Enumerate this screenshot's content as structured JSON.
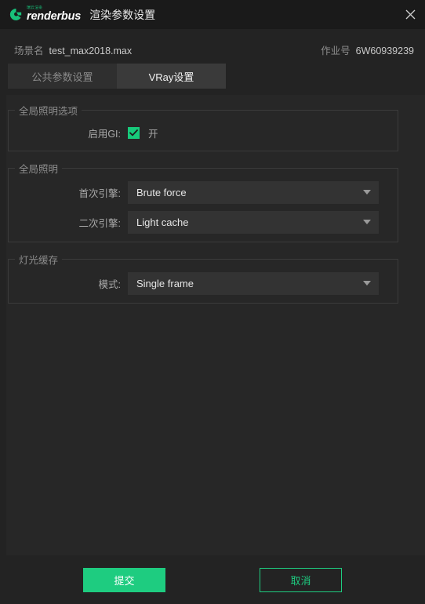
{
  "window": {
    "title": "渲染参数设置",
    "close_icon": "close-icon",
    "logo": {
      "cn_text": "瑞云渲染",
      "name": "renderbus"
    }
  },
  "info": {
    "scene_label": "场景名",
    "scene_value": "test_max2018.max",
    "job_label": "作业号",
    "job_value": "6W60939239"
  },
  "tabs": [
    {
      "label": "公共参数设置",
      "active": false
    },
    {
      "label": "VRay设置",
      "active": true
    }
  ],
  "groups": {
    "gi_options": {
      "legend": "全局照明选项",
      "enable_gi_label": "启用GI:",
      "enable_gi_checked": "checked",
      "enable_gi_text": "开"
    },
    "global_illumination": {
      "legend": "全局照明",
      "primary_label": "首次引擎:",
      "primary_value": "Brute force",
      "secondary_label": "二次引擎:",
      "secondary_value": "Light cache"
    },
    "light_cache": {
      "legend": "灯光缓存",
      "mode_label": "模式:",
      "mode_value": "Single frame"
    }
  },
  "footer": {
    "submit_label": "提交",
    "cancel_label": "取消"
  },
  "colors": {
    "accent": "#1ecc80",
    "checkbox": "#17ca7b",
    "titlebar_bg": "#1a1a1a",
    "content_bg": "#272727"
  }
}
